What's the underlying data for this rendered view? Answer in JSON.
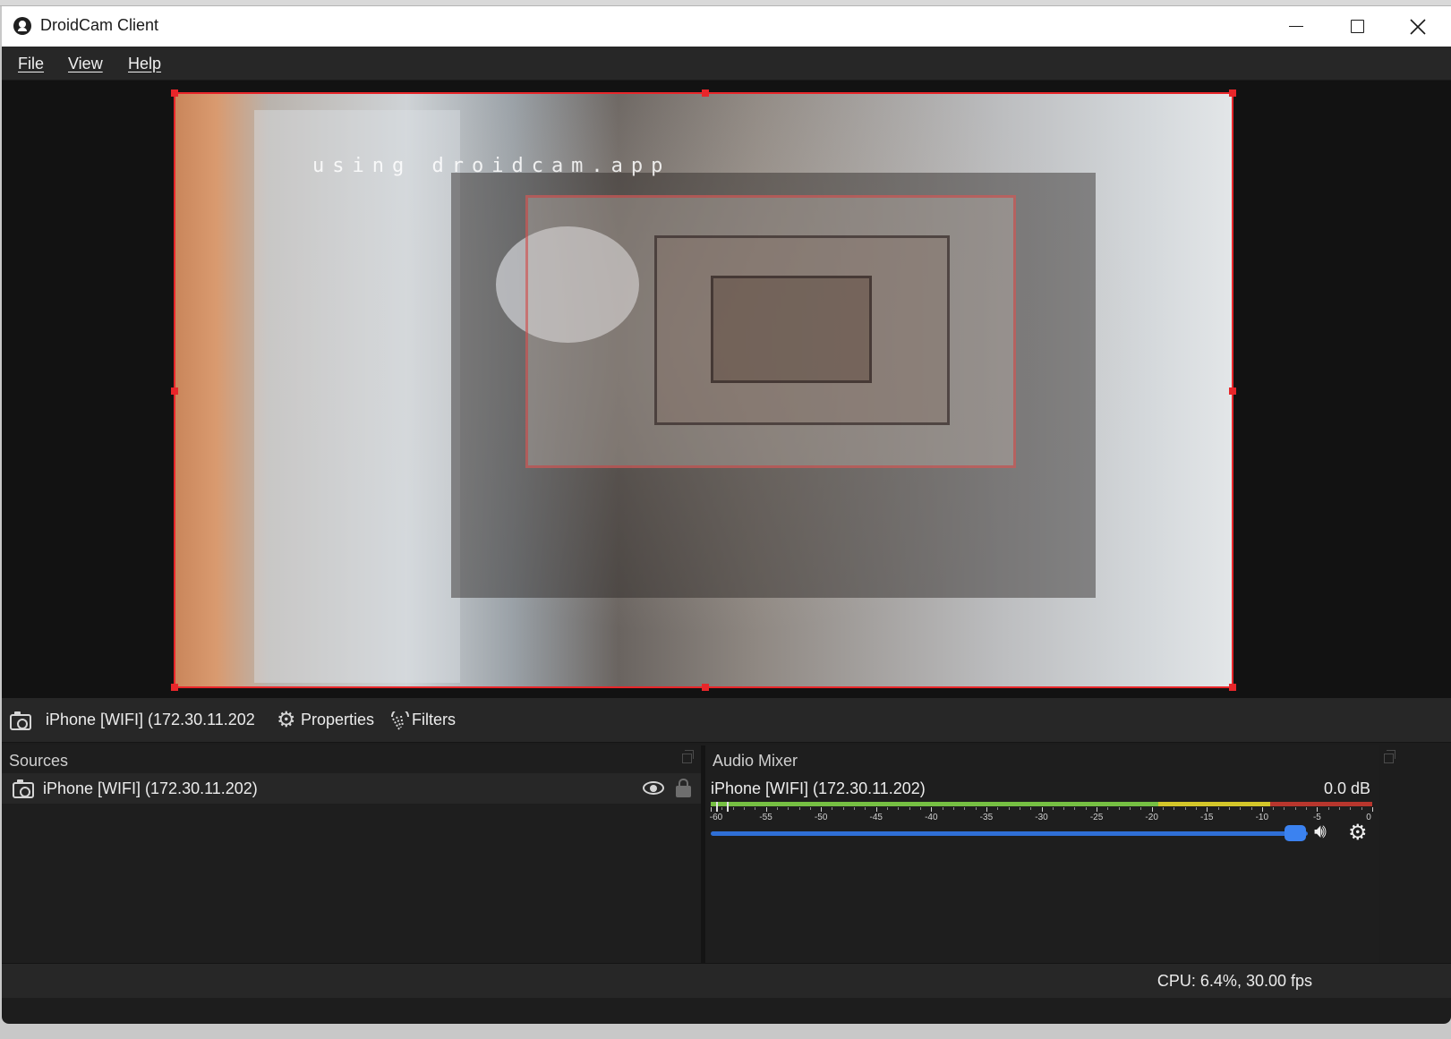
{
  "window": {
    "title": "DroidCam Client"
  },
  "menu": {
    "items": [
      "File",
      "View",
      "Help"
    ]
  },
  "preview": {
    "watermark": "using droidcam.app"
  },
  "toolbar": {
    "source_name": "iPhone [WIFI] (172.30.11.202",
    "properties_label": "Properties",
    "filters_label": "Filters"
  },
  "sources": {
    "title": "Sources",
    "items": [
      {
        "label": "iPhone [WIFI] (172.30.11.202)",
        "visible": true,
        "locked": false
      }
    ]
  },
  "mixer": {
    "title": "Audio Mixer",
    "channel": "iPhone [WIFI] (172.30.11.202)",
    "db": "0.0 dB",
    "scale": [
      "-60",
      "-55",
      "-50",
      "-45",
      "-40",
      "-35",
      "-30",
      "-25",
      "-20",
      "-15",
      "-10",
      "-5",
      "0"
    ],
    "volume_fraction": 1.0
  },
  "status": {
    "text": "CPU: 6.4%, 30.00 fps"
  },
  "colors": {
    "selection": "#e8262a",
    "fader": "#3b82f0",
    "meter_green": "#76c043",
    "meter_yellow": "#d4c62a",
    "meter_red": "#b8362d"
  }
}
